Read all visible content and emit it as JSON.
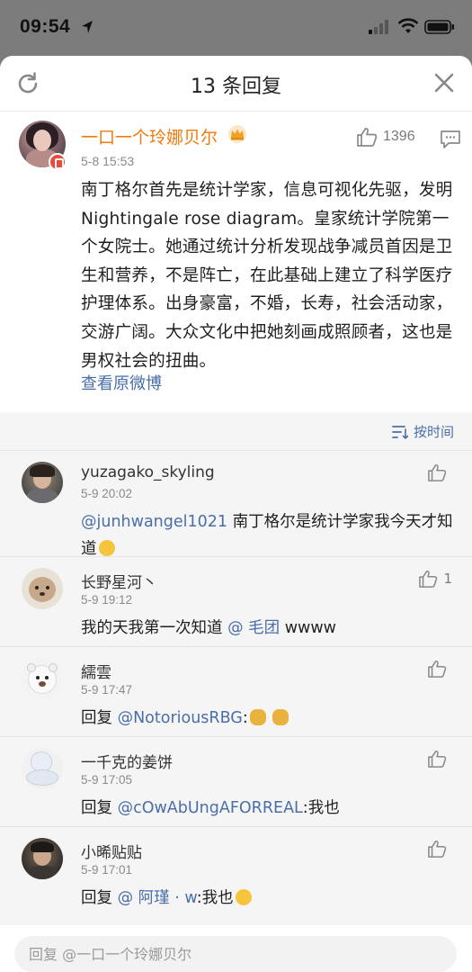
{
  "status": {
    "time": "09:54"
  },
  "header": {
    "title": "13 条回复"
  },
  "main_comment": {
    "user": "一口一个玲娜贝尔",
    "time": "5-8 15:53",
    "likes": "1396",
    "text": "南丁格尔首先是统计学家，信息可视化先驱，发明Nightingale rose diagram。皇家统计学院第一个女院士。她通过统计分析发现战争减员首因是卫生和营养，不是阵亡，在此基础上建立了科学医疗护理体系。出身豪富，不婚，长寿，社会活动家，交游广阔。大众文化中把她刻画成照顾者，这也是男权社会的扭曲。",
    "view_original": "查看原微博"
  },
  "sort": {
    "label": "按时间"
  },
  "replies": [
    {
      "user": "yuzagako_skyling",
      "time": "5-9 20:02",
      "mention": "@junhwangel1021",
      "text": " 南丁格尔是统计学家我今天才知道",
      "likes": ""
    },
    {
      "user": "长野星河丶",
      "time": "5-9 19:12",
      "prefix": "我的天我第一次知道 ",
      "mention": "@ 毛团",
      "text": " wwww",
      "likes": "1"
    },
    {
      "user": "繻雲",
      "time": "5-9 17:47",
      "prefix": "回复 ",
      "mention": "@NotoriousRBG",
      "text": ":",
      "likes": ""
    },
    {
      "user": "一千克的姜饼",
      "time": "5-9 17:05",
      "prefix": "回复 ",
      "mention": "@cOwAbUngAFORREAL",
      "text": ":我也",
      "likes": ""
    },
    {
      "user": "小晞贴贴",
      "time": "5-9 17:01",
      "prefix": "回复 ",
      "mention": "@ 阿瑾 · w",
      "text": ":我也",
      "likes": ""
    }
  ],
  "input": {
    "placeholder": "回复 @一口一个玲娜贝尔"
  },
  "icons": {
    "refresh": "refresh-icon",
    "close": "close-icon",
    "like": "thumbs-up-icon",
    "comment": "comment-icon",
    "sort": "sort-icon",
    "crown": "crown-icon"
  },
  "colors": {
    "username_orange": "#ee7b0a",
    "link_blue": "#4a6ea8"
  }
}
